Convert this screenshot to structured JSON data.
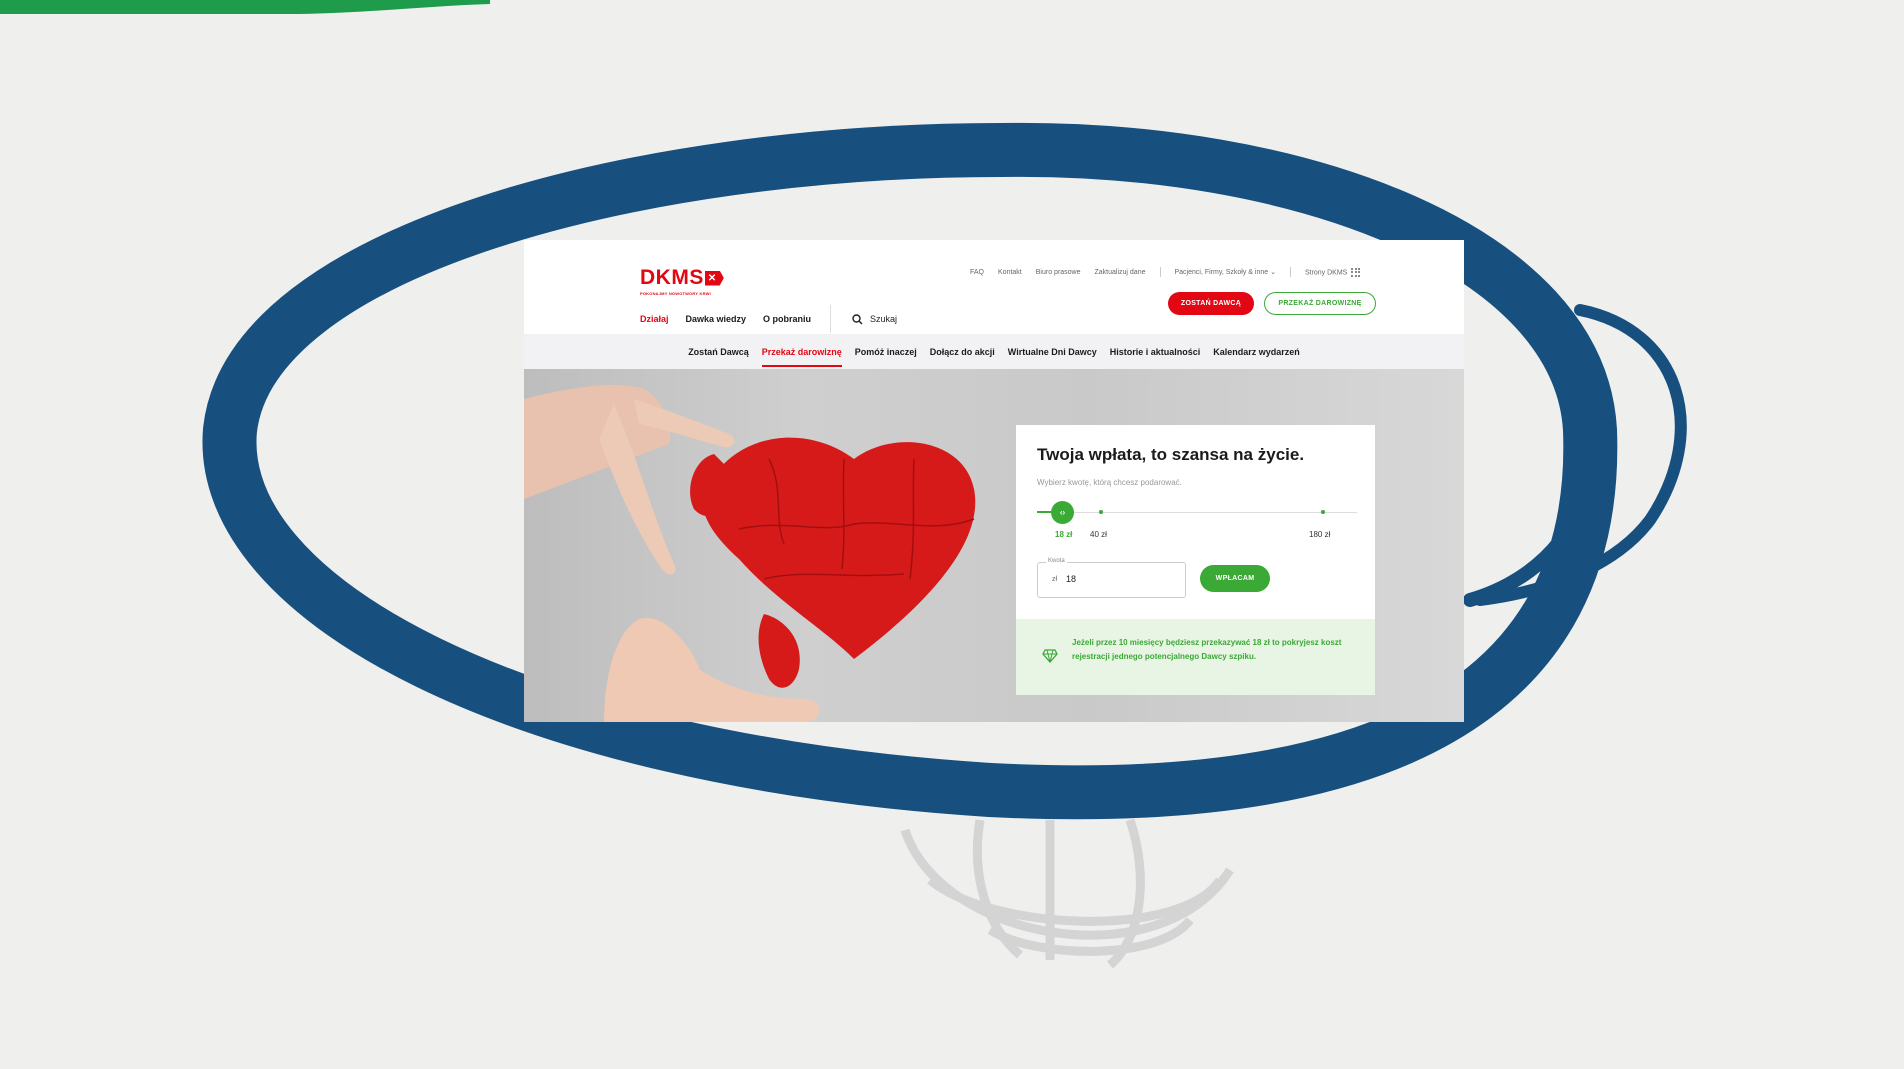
{
  "colors": {
    "brand_red": "#e30613",
    "green": "#3aa935",
    "ellipse_blue": "#17507e"
  },
  "header": {
    "logo_text": "DKMS",
    "logo_tagline": "POKONAJMY NOWOTWORY KRWI",
    "top_links": [
      "FAQ",
      "Kontakt",
      "Biuro prasowe",
      "Zaktualizuj dane",
      "Pacjenci, Firmy, Szkoły & inne",
      "Strony DKMS"
    ],
    "main_nav": [
      "Działaj",
      "Dawka wiedzy",
      "O pobraniu"
    ],
    "active_main_nav": "Działaj",
    "search_label": "Szukaj",
    "btn_become_donor": "ZOSTAŃ DAWCĄ",
    "btn_donate": "PRZEKAŻ DAROWIZNĘ"
  },
  "subnav": {
    "items": [
      "Zostań Dawcą",
      "Przekaż darowiznę",
      "Pomóż inaczej",
      "Dołącz do akcji",
      "Wirtualne Dni Dawcy",
      "Historie i aktualności",
      "Kalendarz wydarzeń"
    ],
    "active": "Przekaż darowiznę"
  },
  "donation_card": {
    "title": "Twoja wpłata, to szansa na życie.",
    "subtitle": "Wybierz kwotę, którą chcesz podarować.",
    "slider_labels": [
      "18 zł",
      "40 zł",
      "180 zł"
    ],
    "slider_selected": "18 zł",
    "amount_label": "Kwota",
    "currency": "zł",
    "amount_value": "18",
    "submit_label": "WPŁACAM",
    "info_text": "Jeżeli przez 10 miesięcy będziesz przekazywać 18 zł to pokryjesz koszt rejestracji jednego potencjalnego Dawcy szpiku."
  },
  "icons": {
    "search": "search-icon",
    "chevron": "chevron-down-icon",
    "grid": "grid-icon",
    "slider_thumb": "arrows-left-right-icon",
    "info": "diamond-icon"
  }
}
